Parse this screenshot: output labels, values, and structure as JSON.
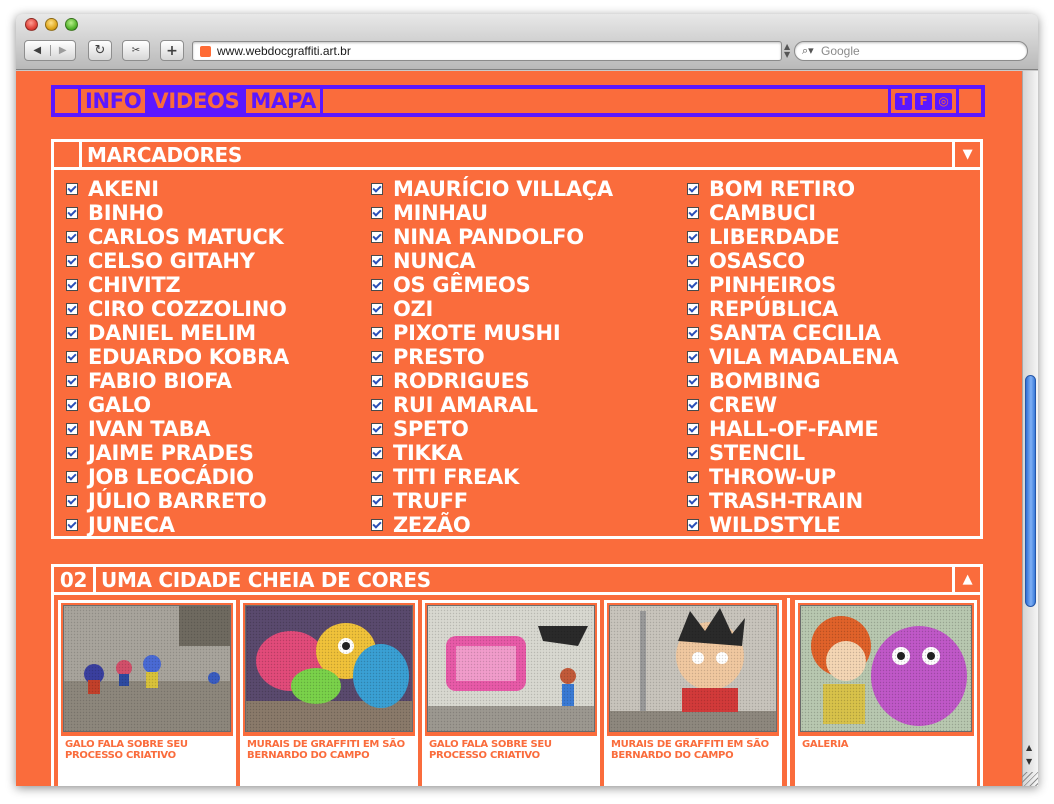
{
  "browser": {
    "url": "www.webdocgraffiti.art.br",
    "search_placeholder": "Google"
  },
  "nav": {
    "items": [
      {
        "label": "INFO",
        "active": false
      },
      {
        "label": "VIDEOS",
        "active": true
      },
      {
        "label": "MAPA",
        "active": false
      }
    ],
    "social": [
      "twitter-icon",
      "facebook-icon",
      "instagram-icon"
    ]
  },
  "colors": {
    "background": "#fa6c3c",
    "nav_accent": "#5b17ff",
    "panel_border": "#ffffff"
  },
  "marcadores": {
    "title": "MARCADORES",
    "toggle_icon": "chevron-down-icon",
    "columns": [
      [
        "AKENI",
        "BINHO",
        "CARLOS MATUCK",
        "CELSO GITAHY",
        "CHIVITZ",
        "CIRO COZZOLINO",
        "DANIEL MELIM",
        "EDUARDO KOBRA",
        "FABIO BIOFA",
        "GALO",
        "IVAN TABA",
        "JAIME PRADES",
        "JOB LEOCÁDIO",
        "JÚLIO BARRETO",
        "JUNECA"
      ],
      [
        "MAURÍCIO VILLAÇA",
        "MINHAU",
        "NINA PANDOLFO",
        "NUNCA",
        "OS GÊMEOS",
        "OZI",
        "PIXOTE MUSHI",
        "PRESTO",
        "RODRIGUES",
        "RUI AMARAL",
        "SPETO",
        "TIKKA",
        "TITI FREAK",
        "TRUFF",
        "ZEZÃO"
      ],
      [
        "BOM RETIRO",
        "CAMBUCI",
        "LIBERDADE",
        "OSASCO",
        "PINHEIROS",
        "REPÚBLICA",
        "SANTA CECILIA",
        "VILA MADALENA",
        "BOMBING",
        "CREW",
        "HALL-OF-FAME",
        "STENCIL",
        "THROW-UP",
        "TRASH-TRAIN",
        "WILDSTYLE"
      ]
    ]
  },
  "section": {
    "number": "02",
    "title": "UMA CIDADE CHEIA DE CORES",
    "toggle_icon": "chevron-up-icon",
    "videos": [
      {
        "caption": "GALO FALA SOBRE SEU PROCESSO CRIATIVO"
      },
      {
        "caption": "MURAIS DE GRAFFITI EM SÃO BERNARDO DO CAMPO"
      },
      {
        "caption": "GALO FALA SOBRE SEU PROCESSO CRIATIVO"
      },
      {
        "caption": "MURAIS DE GRAFFITI EM SÃO BERNARDO DO CAMPO"
      }
    ],
    "gallery": {
      "caption": "GALERIA"
    }
  }
}
